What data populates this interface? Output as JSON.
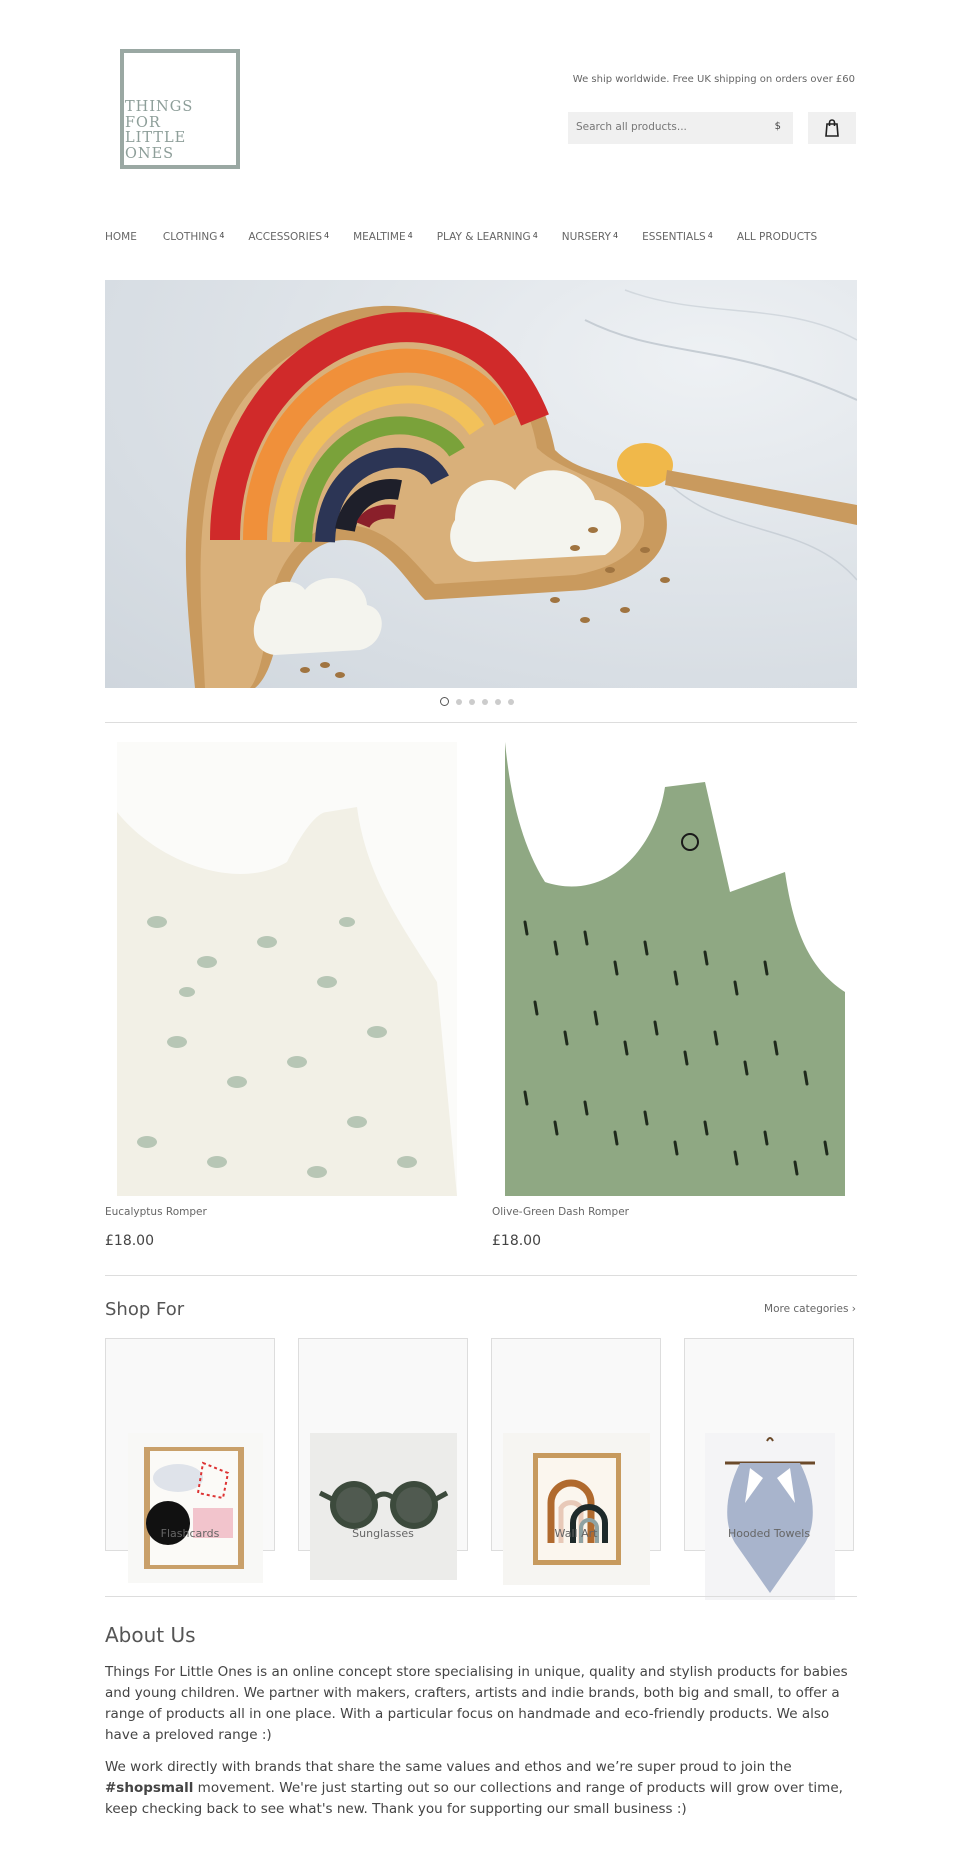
{
  "header": {
    "logo_lines": [
      "THINGS",
      "FOR",
      "LITTLE",
      "ONES"
    ],
    "shipping_note": "We ship worldwide. Free UK shipping on orders over £60",
    "search_placeholder": "Search all products...",
    "search_button": "$"
  },
  "nav": [
    {
      "label": "HOME",
      "count": ""
    },
    {
      "label": "CLOTHING",
      "count": "4"
    },
    {
      "label": "ACCESSORIES",
      "count": "4"
    },
    {
      "label": "MEALTIME",
      "count": "4"
    },
    {
      "label": "PLAY & LEARNING",
      "count": "4"
    },
    {
      "label": "NURSERY",
      "count": "4"
    },
    {
      "label": "ESSENTIALS",
      "count": "4"
    },
    {
      "label": "ALL PRODUCTS",
      "count": ""
    }
  ],
  "slideshow": {
    "slides": 6,
    "active": 1
  },
  "products": [
    {
      "name": "Eucalyptus Romper",
      "price": "£18.00"
    },
    {
      "name": "Olive-Green Dash Romper",
      "price": "£18.00"
    }
  ],
  "shop_for": {
    "title": "Shop For",
    "more_link": "More categories ›",
    "categories": [
      {
        "label": "Flashcards"
      },
      {
        "label": "Sunglasses"
      },
      {
        "label": "Wall Art"
      },
      {
        "label": "Hooded Towels"
      }
    ]
  },
  "about": {
    "title": "About Us",
    "p1": "Things For Little Ones is an online concept store specialising in unique, quality and stylish products for babies and young children. We partner with makers, crafters, artists and indie brands, both big and small, to offer a range of products all in one place. With a particular focus on handmade and eco-friendly products. We also have a preloved range :)",
    "p2_before": "We work directly with brands that share the same values and ethos and we’re super proud to join the ",
    "p2_bold": "#shopsmall",
    "p2_after": " movement. We're just starting out so our collections and range of products will grow over time, keep checking back to see what's new. Thank you for supporting our small business :)"
  },
  "colors": {
    "logo": "#8d9e99",
    "accent_bg": "#f0f0f0"
  }
}
